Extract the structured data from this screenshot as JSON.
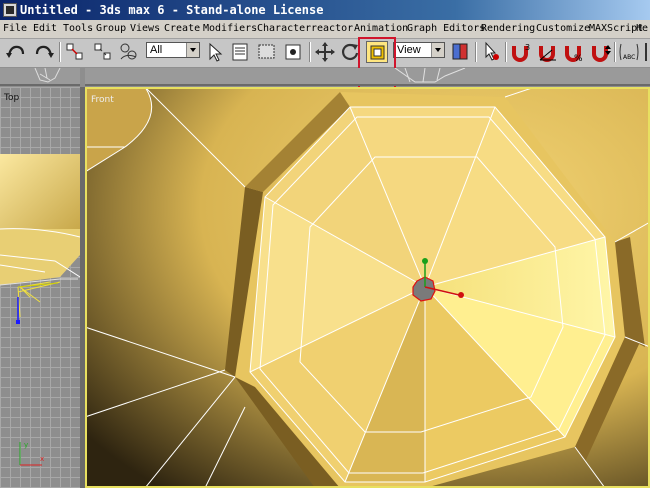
{
  "window": {
    "title": "Untitled - 3ds max 6 - Stand-alone License",
    "icon": "3dsmax-app-icon"
  },
  "menu": {
    "items": [
      "File",
      "Edit",
      "Tools",
      "Group",
      "Views",
      "Create",
      "Modifiers",
      "Character",
      "reactor",
      "Animation",
      "Graph Editors",
      "Rendering",
      "Customize",
      "MAXScript",
      "He"
    ]
  },
  "toolbar": {
    "selection_filter": "All",
    "reference_coord": "View",
    "icons": [
      "undo-icon",
      "redo-icon",
      "select-and-link-icon",
      "unlink-icon",
      "bind-space-warp-icon",
      "select-object-icon",
      "select-by-name-icon",
      "rectangular-selection-icon",
      "window-crossing-icon",
      "select-and-move-icon",
      "select-and-rotate-icon",
      "select-and-scale-icon",
      "use-pivot-center-icon",
      "select-and-manipulate-icon",
      "snaps-toggle-icon",
      "angle-snap-icon",
      "percent-snap-icon",
      "spinner-snap-icon",
      "named-selection-icon",
      "mirror-icon"
    ]
  },
  "viewports": {
    "top_label": "Top",
    "front_label": "Front"
  },
  "highlight_color": "#d0142c"
}
